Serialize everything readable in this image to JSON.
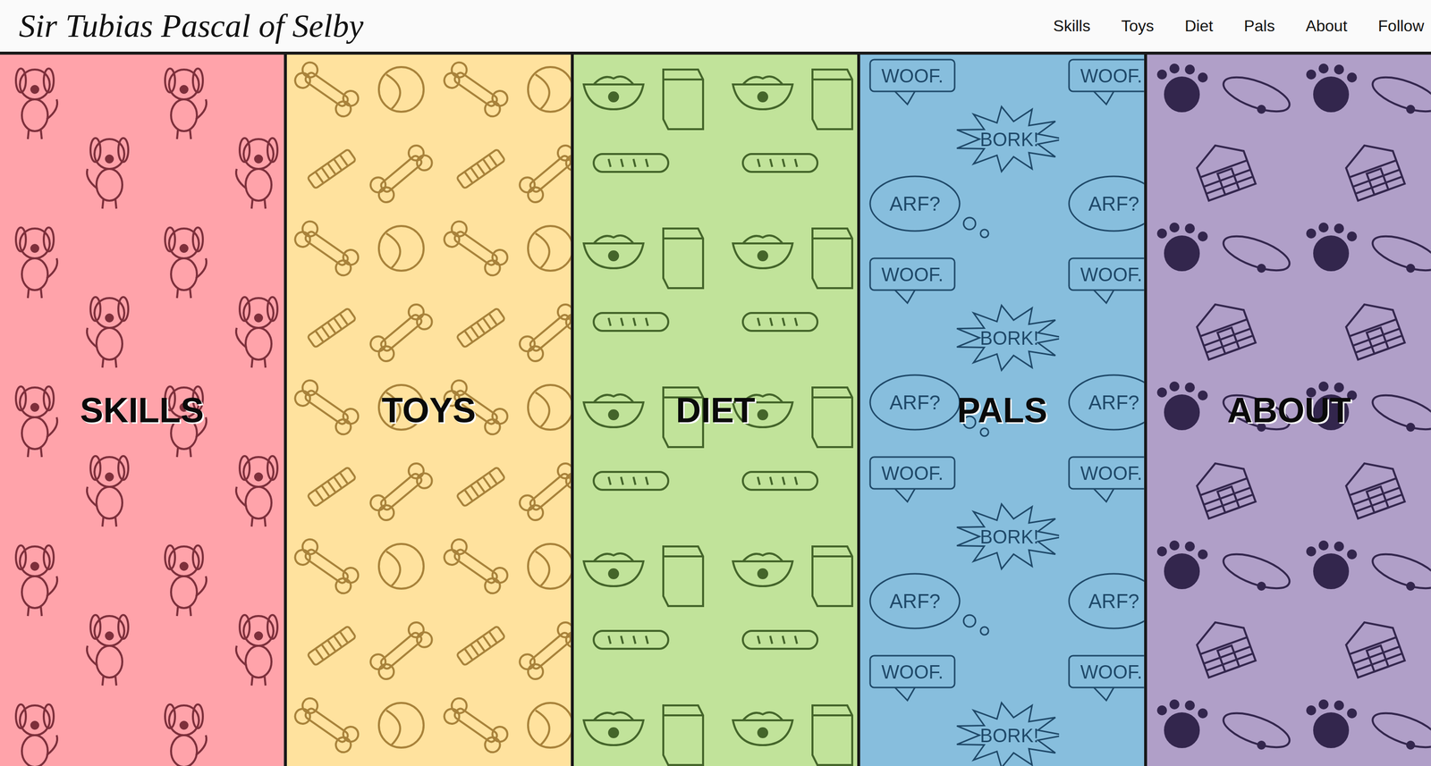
{
  "header": {
    "title": "Sir Tubias Pascal of Selby",
    "nav": [
      {
        "label": "Skills"
      },
      {
        "label": "Toys"
      },
      {
        "label": "Diet"
      },
      {
        "label": "Pals"
      },
      {
        "label": "About"
      },
      {
        "label": "Follow"
      }
    ]
  },
  "panels": [
    {
      "label": "SKILLS",
      "kind": "dogs",
      "color": "#ffa3aa",
      "ink": "#7d2f3b"
    },
    {
      "label": "TOYS",
      "kind": "toys",
      "color": "#ffe29e",
      "ink": "#a8823a"
    },
    {
      "label": "DIET",
      "kind": "food",
      "color": "#c1e39a",
      "ink": "#44652a"
    },
    {
      "label": "PALS",
      "kind": "speech",
      "color": "#87bedd",
      "ink": "#1e4868",
      "words": [
        "WOOF.",
        "BORK!",
        "ARF?"
      ]
    },
    {
      "label": "ABOUT",
      "kind": "home",
      "color": "#b09fc8",
      "ink": "#33264d"
    }
  ]
}
